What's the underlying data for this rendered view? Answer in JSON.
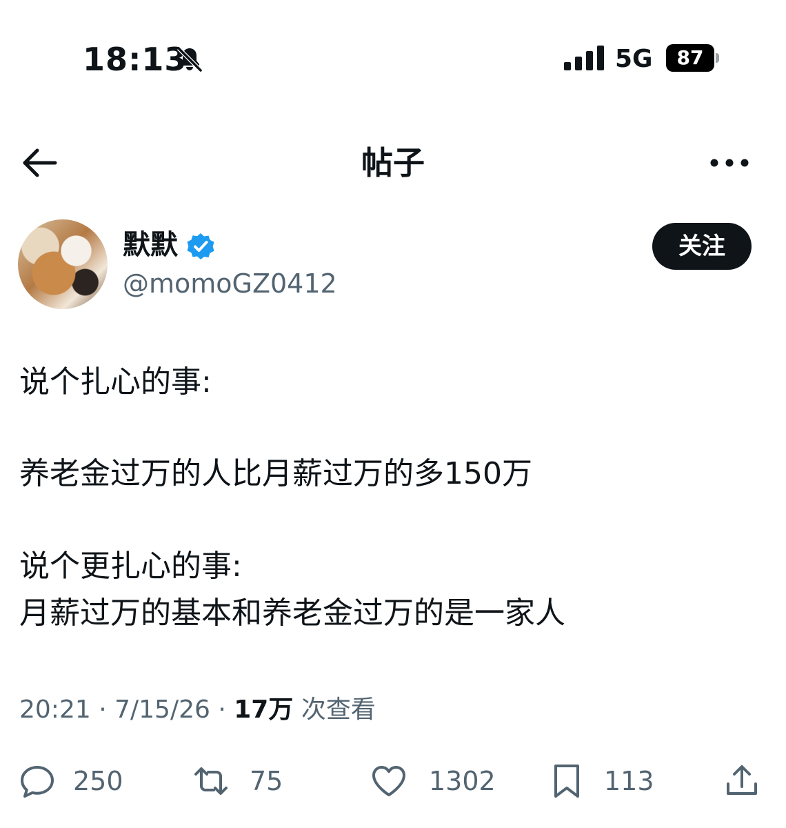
{
  "status_bar": {
    "time": "18:13",
    "network": "5G",
    "battery": "87",
    "icons": [
      "bell-slash-icon",
      "signal-bars-icon",
      "battery-icon"
    ]
  },
  "header": {
    "title": "帖子",
    "icons": [
      "back-arrow-icon",
      "more-options-icon"
    ]
  },
  "author": {
    "name": "默默",
    "handle": "@momoGZ0412",
    "verified_icon": "verified-badge-icon",
    "verified_color": "#1d9bf0",
    "follow_label": "关注"
  },
  "post": {
    "lines": [
      "说个扎心的事:",
      "养老金过万的人比月薪过万的多150万",
      "说个更扎心的事:",
      "月薪过万的基本和养老金过万的是一家人"
    ]
  },
  "meta": {
    "time": "20:21",
    "sep1": "·",
    "date": "7/15/26",
    "sep2": "·",
    "views_count": "17万",
    "views_label": "次查看"
  },
  "actions": {
    "reply": {
      "icon": "reply-icon",
      "count": "250"
    },
    "repost": {
      "icon": "repost-icon",
      "count": "75"
    },
    "like": {
      "icon": "heart-icon",
      "count": "1302"
    },
    "bookmark": {
      "icon": "bookmark-icon",
      "count": "113"
    },
    "share": {
      "icon": "share-icon"
    }
  }
}
